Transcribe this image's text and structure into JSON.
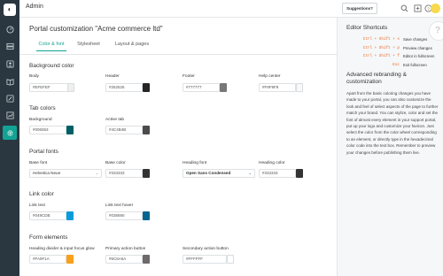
{
  "header": {
    "title": "Admin",
    "suggestions_label": "Suggestions?"
  },
  "sidebar": {
    "logo_icon": "zendesk-logo",
    "items": [
      {
        "icon": "gauge-icon",
        "active": false
      },
      {
        "icon": "server-icon",
        "active": false
      },
      {
        "icon": "contact-card-icon",
        "active": false
      },
      {
        "icon": "book-icon",
        "active": false
      },
      {
        "icon": "pencil-icon",
        "active": false
      },
      {
        "icon": "chart-icon",
        "active": false
      },
      {
        "icon": "gear-icon",
        "active": true
      }
    ],
    "accent": "#12a394"
  },
  "main": {
    "title": "Portal customization \"Acme commerce ltd\"",
    "tabs": [
      {
        "label": "Color & font",
        "active": true
      },
      {
        "label": "Stylesheet",
        "active": false
      },
      {
        "label": "Layout & pages",
        "active": false
      }
    ],
    "sections": {
      "background": {
        "title": "Background color",
        "fields": [
          {
            "label": "Body",
            "value": "#EFEFEF",
            "color": "#efefef"
          },
          {
            "label": "Header",
            "value": "#252525",
            "color": "#252525"
          },
          {
            "label": "Footer",
            "value": "#777777",
            "color": "#777777"
          },
          {
            "label": "Help center",
            "value": "#F9F9F9",
            "color": "#f9f9f9"
          }
        ]
      },
      "tab": {
        "title": "Tab colors",
        "fields": [
          {
            "label": "Background",
            "value": "#006063",
            "color": "#006063"
          },
          {
            "label": "Active tab",
            "value": "#4C4B4B",
            "color": "#4c4b4b"
          }
        ]
      },
      "fonts": {
        "title": "Portal fonts",
        "base_font_label": "Base font",
        "base_font_value": "Helvetica Neue",
        "base_color_label": "Base color",
        "base_color_value": "#333333",
        "base_color_color": "#333333",
        "heading_font_label": "Heading font",
        "heading_font_value": "Open Sans Condensed",
        "heading_color_label": "Heading color",
        "heading_color_value": "#333333",
        "heading_color_color": "#333333"
      },
      "link": {
        "title": "Link color",
        "fields": [
          {
            "label": "Link text",
            "value": "#049CDB",
            "color": "#049cdb"
          },
          {
            "label": "Link text hover",
            "value": "#036690",
            "color": "#036690"
          }
        ]
      },
      "form": {
        "title": "Form elements",
        "fields": [
          {
            "label": "Heading divider & input focus glow",
            "value": "#FA9F1A",
            "color": "#fa9f1a"
          },
          {
            "label": "Primary action button",
            "value": "#6C6A6A",
            "color": "#6c6a6a"
          },
          {
            "label": "Secondary action button",
            "value": "#FFFFFF",
            "color": "#ffffff"
          }
        ]
      }
    }
  },
  "right_panel": {
    "shortcuts_title": "Editor Shortcuts",
    "shortcuts": [
      {
        "keys": "Ctrl + Shift + s",
        "desc": "Save changes"
      },
      {
        "keys": "Ctrl + Shift + p",
        "desc": "Preview changes"
      },
      {
        "keys": "Ctrl + Shift + f",
        "desc": "Editor in fullscreen"
      },
      {
        "keys": "Esc",
        "desc": "Exit fullscreen"
      }
    ],
    "rebrand_title": "Advanced rebranding & customization",
    "rebrand_body": "Apart from the basic coloring changes you have made to your portal, you can also customize the look and feel of select aspects of the page to further match your brand. You can stylize, color and set the font of almost every element in your support portal, put up your logo and customize your favicon. Just select the color from the color wheel corresponding to an element, or directly type in the hexadecimal color code into the text box. Remember to preview your changes before publishing them live."
  }
}
